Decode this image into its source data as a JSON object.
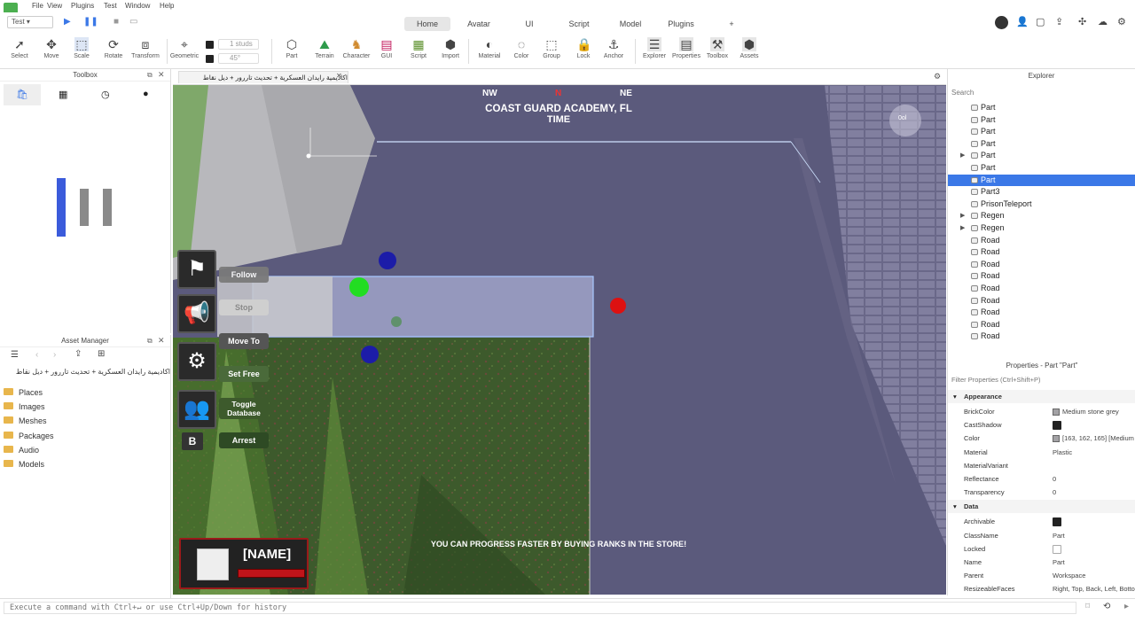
{
  "menu": {
    "items": [
      "File",
      "View",
      "Plugins",
      "Test",
      "Window",
      "Help"
    ]
  },
  "tabs": {
    "items": [
      "Home",
      "Avatar",
      "UI",
      "Script",
      "Model",
      "Plugins"
    ],
    "active": "Home",
    "add": "+"
  },
  "test_mode": "Test",
  "ribbon": {
    "tools": [
      "Select",
      "Move",
      "Scale",
      "Rotate",
      "Transform"
    ],
    "geometric": "Geometric",
    "snap_studs": "1 studs",
    "snap_deg": "45°",
    "insert": [
      "Part",
      "Terrain",
      "Character",
      "GUI",
      "Script",
      "Import"
    ],
    "edit": [
      "Material",
      "Color",
      "Group",
      "Lock",
      "Anchor"
    ],
    "show": [
      "Explorer",
      "Properties",
      "Toolbox",
      "Assets"
    ]
  },
  "toolbox": {
    "title": "Toolbox"
  },
  "asset_manager": {
    "title": "Asset Manager",
    "place_name": "اكاديمية رايدان العسكرية + تحديث تاررور + ديل نقاط",
    "folders": [
      "Places",
      "Images",
      "Meshes",
      "Packages",
      "Audio",
      "Models"
    ]
  },
  "viewport": {
    "tab_label": "اكاديمية رايدان العسكرية + تحديث تاررور + ديل نقاط",
    "compass": {
      "left": "NW",
      "center": "N",
      "right": "NE"
    },
    "location": "COAST GUARD ACADEMY, FL",
    "time_label": "TIME",
    "compass_badge": "0ol",
    "hint": "YOU CAN PROGRESS FASTER BY BUYING RANKS IN THE STORE!",
    "actions": [
      "Follow",
      "Stop",
      "Move To",
      "Set Free",
      "Toggle Database",
      "Arrest"
    ],
    "arrest_key": "B",
    "name_tag": "[NAME]"
  },
  "explorer": {
    "title": "Explorer",
    "search_placeholder": "Search",
    "items": [
      {
        "label": "Part",
        "expandable": false,
        "selected": false
      },
      {
        "label": "Part",
        "expandable": false,
        "selected": false
      },
      {
        "label": "Part",
        "expandable": false,
        "selected": false
      },
      {
        "label": "Part",
        "expandable": false,
        "selected": false
      },
      {
        "label": "Part",
        "expandable": true,
        "selected": false
      },
      {
        "label": "Part",
        "expandable": false,
        "selected": false
      },
      {
        "label": "Part",
        "expandable": false,
        "selected": true
      },
      {
        "label": "Part3",
        "expandable": false,
        "selected": false
      },
      {
        "label": "PrisonTeleport",
        "expandable": false,
        "selected": false
      },
      {
        "label": "Regen",
        "expandable": true,
        "selected": false
      },
      {
        "label": "Regen",
        "expandable": true,
        "selected": false
      },
      {
        "label": "Road",
        "expandable": false,
        "selected": false
      },
      {
        "label": "Road",
        "expandable": false,
        "selected": false
      },
      {
        "label": "Road",
        "expandable": false,
        "selected": false
      },
      {
        "label": "Road",
        "expandable": false,
        "selected": false
      },
      {
        "label": "Road",
        "expandable": false,
        "selected": false
      },
      {
        "label": "Road",
        "expandable": false,
        "selected": false
      },
      {
        "label": "Road",
        "expandable": false,
        "selected": false
      },
      {
        "label": "Road",
        "expandable": false,
        "selected": false
      },
      {
        "label": "Road",
        "expandable": false,
        "selected": false
      }
    ]
  },
  "properties": {
    "title": "Properties - Part \"Part\"",
    "filter_placeholder": "Filter Properties (Ctrl+Shift+P)",
    "sections": [
      {
        "name": "Appearance",
        "rows": [
          {
            "key": "BrickColor",
            "value": "Medium stone grey",
            "type": "swatch"
          },
          {
            "key": "CastShadow",
            "value": "",
            "type": "check-on"
          },
          {
            "key": "Color",
            "value": "[163, 162, 165] [Medium",
            "type": "swatch"
          },
          {
            "key": "Material",
            "value": "Plastic",
            "type": "text"
          },
          {
            "key": "MaterialVariant",
            "value": "",
            "type": "text"
          },
          {
            "key": "Reflectance",
            "value": "0",
            "type": "text"
          },
          {
            "key": "Transparency",
            "value": "0",
            "type": "text"
          }
        ]
      },
      {
        "name": "Data",
        "rows": [
          {
            "key": "Archivable",
            "value": "",
            "type": "check-on"
          },
          {
            "key": "ClassName",
            "value": "Part",
            "type": "text"
          },
          {
            "key": "Locked",
            "value": "",
            "type": "check-off"
          },
          {
            "key": "Name",
            "value": "Part",
            "type": "text"
          },
          {
            "key": "Parent",
            "value": "Workspace",
            "type": "text"
          },
          {
            "key": "ResizeableFaces",
            "value": "Right, Top, Back, Left, Botto",
            "type": "text"
          }
        ]
      }
    ]
  },
  "command_bar": {
    "placeholder": "Execute a command with Ctrl+↵ or use Ctrl+Up/Down for history"
  },
  "colors": {
    "accent": "#3b78e7",
    "viewport_floor": "#5a5878"
  }
}
